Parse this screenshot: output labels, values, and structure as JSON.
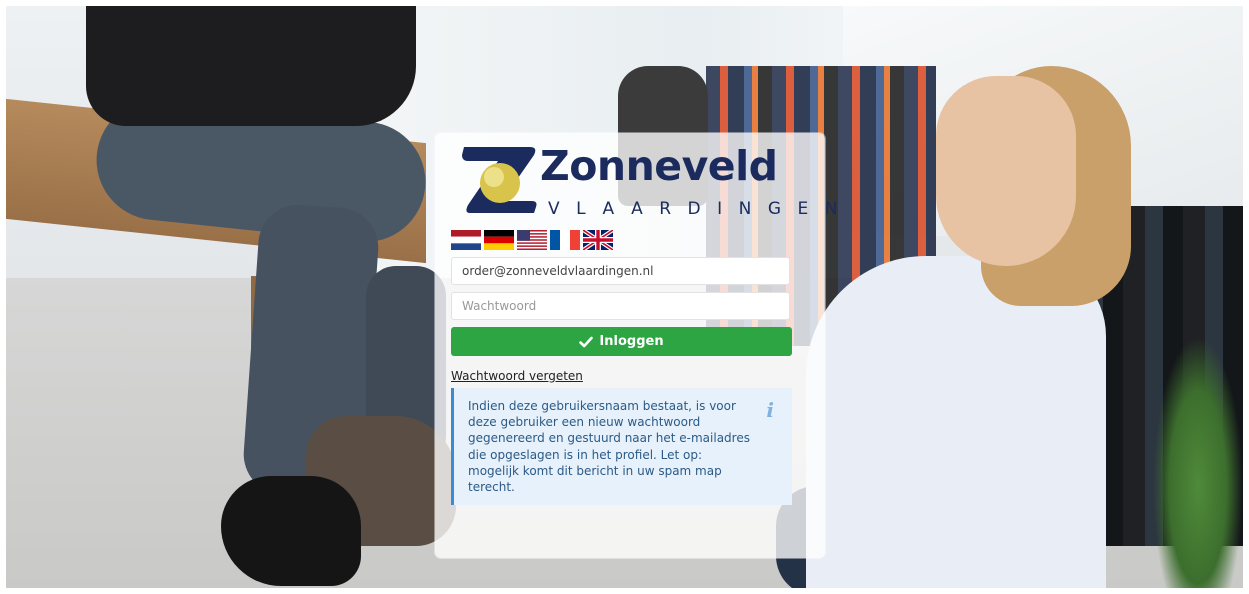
{
  "brand": {
    "name": "Zonneveld",
    "subtitle": "VLAARDINGEN",
    "color": "#1b2b5e"
  },
  "languages": [
    "nl-flag-icon",
    "de-flag-icon",
    "us-flag-icon",
    "fr-flag-icon",
    "uk-flag-icon"
  ],
  "form": {
    "email_value": "order@zonneveldvlaardingen.nl",
    "password_placeholder": "Wachtwoord",
    "login_label": "Inloggen",
    "login_color": "#2ea543"
  },
  "forgot_password": "Wachtwoord vergeten",
  "info_message": "Indien deze gebruikersnaam bestaat, is voor deze gebruiker een nieuw wachtwoord gegenereerd en gestuurd naar het e-mailadres die opgeslagen is in het profiel. Let op: mogelijk komt dit bericht in uw spam map terecht."
}
